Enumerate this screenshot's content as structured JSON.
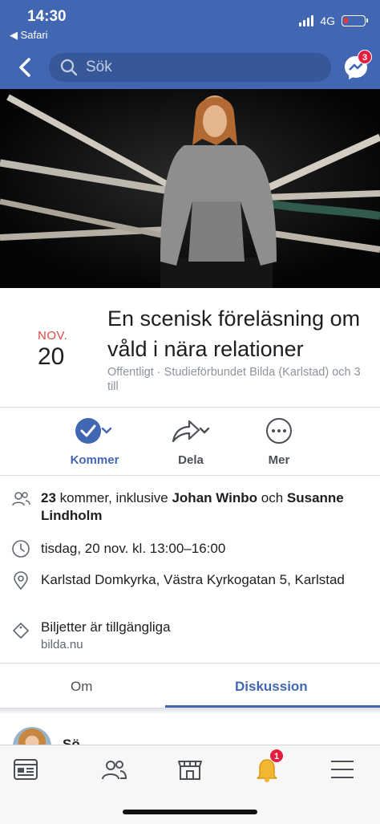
{
  "status": {
    "time": "14:30",
    "back_app": "◀ Safari",
    "network": "4G"
  },
  "nav": {
    "search_placeholder": "Sök",
    "messenger_badge": "3"
  },
  "event": {
    "month": "NOV.",
    "day": "20",
    "title": "En scenisk föreläsning om våld i nära relationer",
    "meta": "Offentligt · Studieförbundet Bilda (Karlstad) och 3 till"
  },
  "actions": [
    {
      "label": "Kommer"
    },
    {
      "label": "Dela"
    },
    {
      "label": "Mer"
    }
  ],
  "info": {
    "going_count": "23",
    "going_text": " kommer, inklusive ",
    "going_name1": "Johan Winbo",
    "going_and": " och ",
    "going_name2": "Susanne Lindholm",
    "datetime": "tisdag, 20 nov. kl. 13:00–16:00",
    "location": "Karlstad Domkyrka, Västra Kyrkogatan 5, Karlstad",
    "tickets": "Biljetter är tillgängliga",
    "tickets_link": "bilda.nu"
  },
  "tabs": {
    "about": "Om",
    "discussion": "Diskussion"
  },
  "post_preview": {
    "partial_text": "Sö"
  },
  "bottom_nav": {
    "notifications_badge": "1"
  },
  "colors": {
    "brand": "#4267b2",
    "date_red": "#e0463f",
    "badge_red": "#e41e3f"
  }
}
